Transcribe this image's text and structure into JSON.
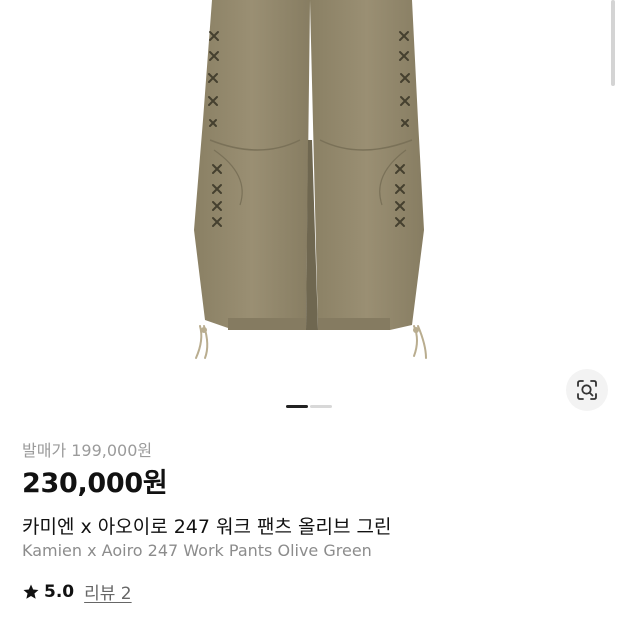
{
  "product": {
    "image_alt": "Olive green work pants",
    "release_price_label": "발매가 199,000원",
    "price": "230,000원",
    "title_ko": "카미엔 x 아오이로 247 워크 팬츠 올리브 그린",
    "title_en": "Kamien x Aoiro 247 Work Pants Olive Green",
    "rating": "5.0",
    "review_link": "리뷰 2"
  },
  "gallery": {
    "page_index": 1,
    "page_count": 2
  },
  "icons": {
    "lens": "image-search-icon",
    "star": "star-icon"
  },
  "colors": {
    "pants": "#958a6e",
    "pants_shadow": "#7e755b",
    "stitch": "#4a4536",
    "text_muted": "#9b9b9b"
  }
}
